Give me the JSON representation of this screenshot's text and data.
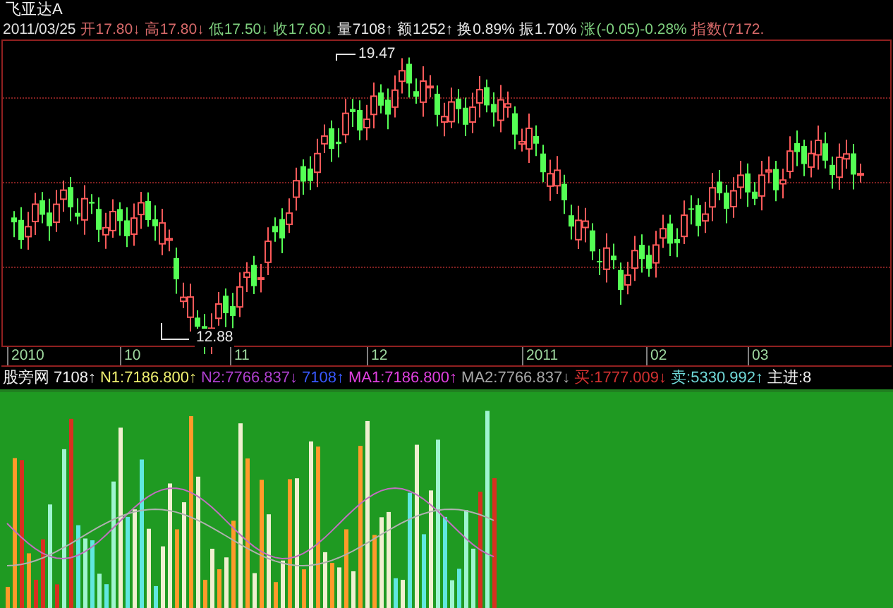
{
  "stock": {
    "name": "飞亚达A"
  },
  "quote_bar": [
    {
      "text": "2011/03/25",
      "color": "#e0e0e0"
    },
    {
      "text": "开17.80",
      "arrow": "↓",
      "color": "#d86a6a"
    },
    {
      "text": "高17.80",
      "arrow": "↓",
      "color": "#d86a6a"
    },
    {
      "text": "低17.50",
      "arrow": "↓",
      "color": "#7fd07f"
    },
    {
      "text": "收17.60",
      "arrow": "↓",
      "color": "#7fd07f"
    },
    {
      "text": "量7108",
      "arrow": "↑",
      "color": "#e8e8e8"
    },
    {
      "text": "额1252",
      "arrow": "↑",
      "color": "#e8e8e8"
    },
    {
      "text": "换0.89%",
      "color": "#e8e8e8"
    },
    {
      "text": "振1.70%",
      "color": "#e8e8e8"
    },
    {
      "text": "涨(-0.05)-0.28%",
      "color": "#7fd07f"
    },
    {
      "text": "指数(7172.",
      "color": "#d86a6a"
    }
  ],
  "price_chart": {
    "high_label": "19.47",
    "low_label": "12.88"
  },
  "time_axis": [
    "2010",
    "10",
    "11",
    "12",
    "2011",
    "02",
    "03"
  ],
  "indicator_legend": [
    {
      "text": "股旁网",
      "color": "#f0f0f0"
    },
    {
      "text": "7108",
      "arrow": "↑",
      "color": "#f0f0f0"
    },
    {
      "text": "N1:7186.800",
      "arrow": "↑",
      "color": "#f0f070"
    },
    {
      "text": "N2:7766.837",
      "arrow": "↓",
      "color": "#b040d0"
    },
    {
      "text": "7108",
      "arrow": "↑",
      "color": "#3858ff"
    },
    {
      "text": "MA1:7186.800",
      "arrow": "↑",
      "color": "#e040e0"
    },
    {
      "text": "MA2:7766.837",
      "arrow": "↓",
      "color": "#a8a8a8"
    },
    {
      "text": "买:1777.009",
      "arrow": "↓",
      "color": "#d03030"
    },
    {
      "text": "卖:5330.992",
      "arrow": "↑",
      "color": "#70d8d8"
    },
    {
      "text": "主进:8",
      "color": "#f0f0f0"
    }
  ]
}
